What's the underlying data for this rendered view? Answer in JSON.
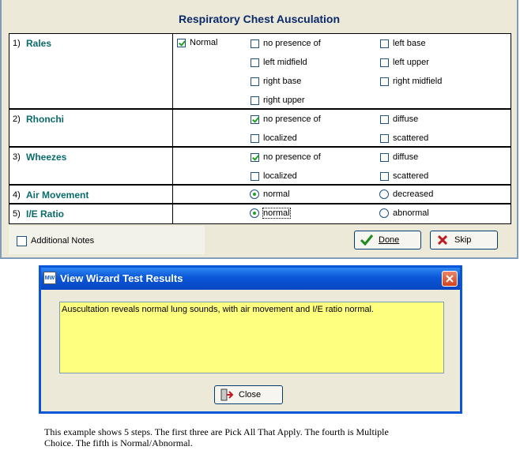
{
  "wizard": {
    "title": "Respiratory Chest Ausculation",
    "steps": [
      {
        "num": "1)",
        "name": "Rales",
        "options": [
          {
            "label": "Normal",
            "checked": true
          },
          {
            "label": "no presence of",
            "checked": false
          },
          {
            "label": "left base",
            "checked": false
          },
          {
            "label": "left midfield",
            "checked": false
          },
          {
            "label": "left upper",
            "checked": false
          },
          {
            "label": "right base",
            "checked": false
          },
          {
            "label": "right midfield",
            "checked": false
          },
          {
            "label": "right upper",
            "checked": false
          }
        ]
      },
      {
        "num": "2)",
        "name": "Rhonchi",
        "options": [
          {
            "label": "no presence of",
            "checked": true
          },
          {
            "label": "diffuse",
            "checked": false
          },
          {
            "label": "localized",
            "checked": false
          },
          {
            "label": "scattered",
            "checked": false
          }
        ]
      },
      {
        "num": "3)",
        "name": "Wheezes",
        "options": [
          {
            "label": "no presence of",
            "checked": true
          },
          {
            "label": "diffuse",
            "checked": false
          },
          {
            "label": "localized",
            "checked": false
          },
          {
            "label": "scattered",
            "checked": false
          }
        ]
      },
      {
        "num": "4)",
        "name": "Air Movement",
        "options": [
          {
            "label": "normal",
            "checked": true
          },
          {
            "label": "decreased",
            "checked": false
          }
        ]
      },
      {
        "num": "5)",
        "name": "I/E Ratio",
        "options": [
          {
            "label": "normal",
            "checked": true
          },
          {
            "label": "abnormal",
            "checked": false
          }
        ]
      }
    ],
    "additional_notes_label": "Additional Notes",
    "done_label": "Done",
    "skip_label": "Skip"
  },
  "results_dialog": {
    "title": "View Wizard Test Results",
    "text": "Auscultation reveals normal lung sounds, with air movement and I/E ratio normal.",
    "close_label": "Close"
  },
  "caption": {
    "line1": "This example shows 5 steps.  The first three are Pick All That Apply.  The fourth is Multiple",
    "line2": "Choice.  The fifth is Normal/Abnormal."
  },
  "colors": {
    "step_label": "#0b6b6b",
    "title_bar": "#0a56d8",
    "result_bg": "#ffff7f",
    "check_green": "#21a121"
  }
}
